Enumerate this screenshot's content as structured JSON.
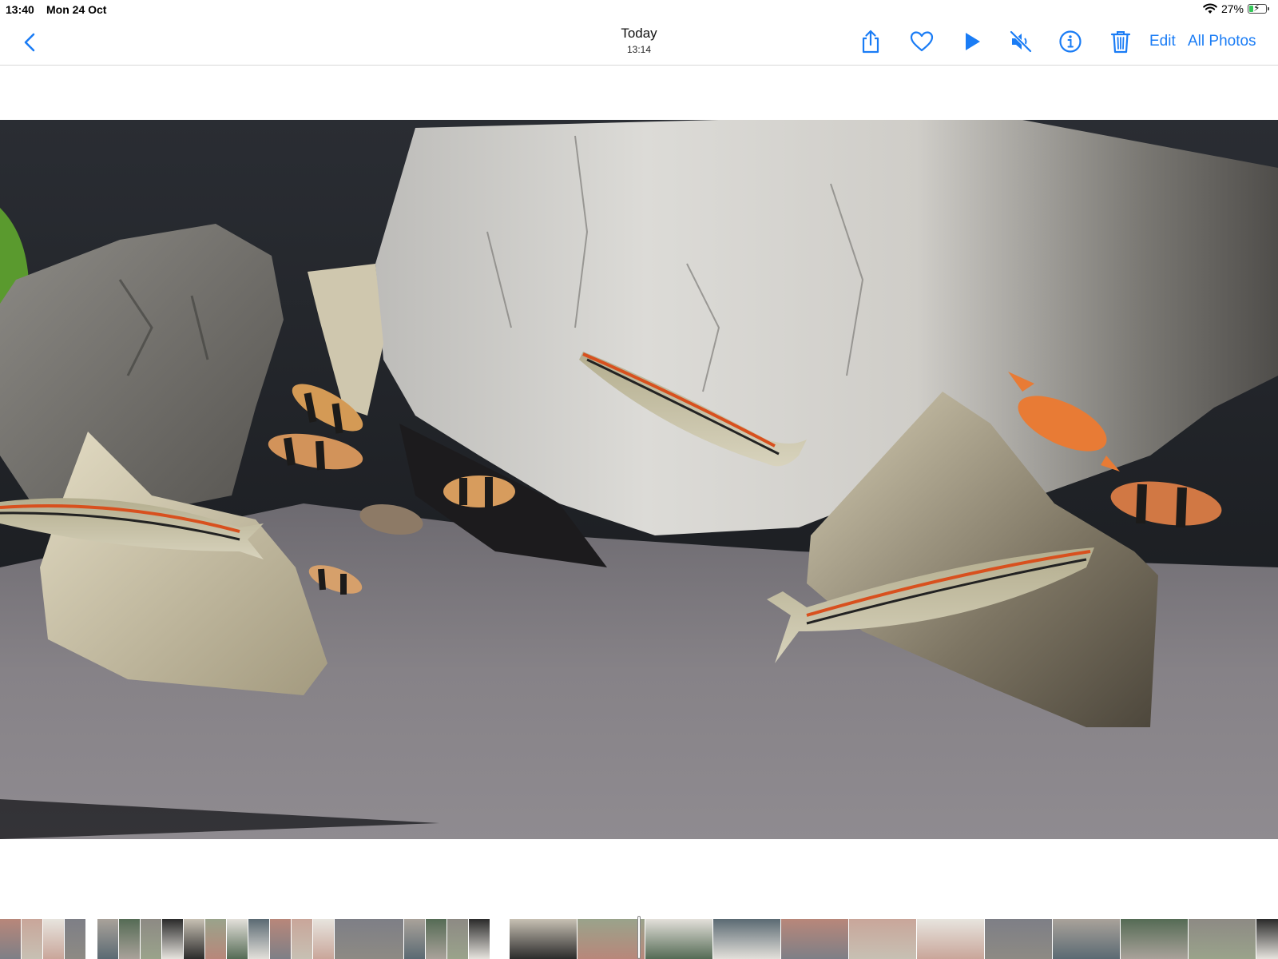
{
  "status_bar": {
    "time": "13:40",
    "date": "Mon 24 Oct",
    "battery_percent": "27%",
    "battery_level": 0.27,
    "wifi_icon": "wifi-icon",
    "charging_icon": "charging-bolt-icon"
  },
  "nav": {
    "title": "Today",
    "subtitle": "13:14",
    "edit_label": "Edit",
    "all_photos_label": "All Photos",
    "accent_color": "#1a7cf5",
    "icons": [
      "back-chevron-icon",
      "share-icon",
      "heart-icon",
      "play-icon",
      "mute-icon",
      "info-icon",
      "trash-icon"
    ]
  },
  "photo": {
    "subject_colors": {
      "background_dark": "#1e1f23",
      "rock_light": "#d4d2cd",
      "sand": "#7d7a80",
      "fish_stripe": "#d8501e"
    }
  },
  "film_strip": {
    "thumbnail_count": 32,
    "selected_index": 15
  }
}
